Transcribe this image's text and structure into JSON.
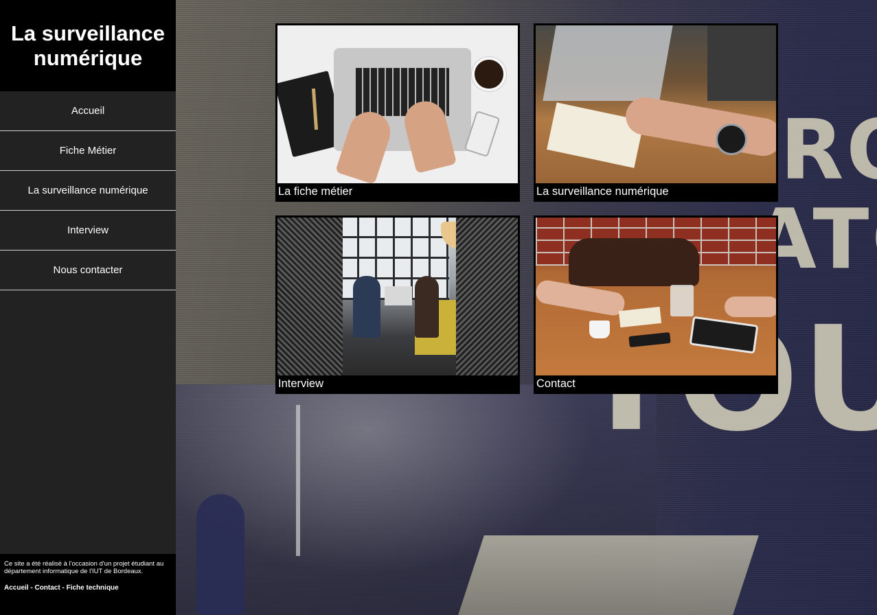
{
  "site": {
    "title": "La surveillance numérique"
  },
  "nav": {
    "items": [
      {
        "label": "Accueil"
      },
      {
        "label": "Fiche Métier"
      },
      {
        "label": "La surveillance numérique"
      },
      {
        "label": "Interview"
      },
      {
        "label": "Nous contacter"
      }
    ]
  },
  "tiles": [
    {
      "caption": "La fiche métier"
    },
    {
      "caption": "La surveillance numérique"
    },
    {
      "caption": "Interview"
    },
    {
      "caption": "Contact"
    }
  ],
  "footer": {
    "text": "Ce site a été réalisé à l'occasion d'un projet étudiant au département informatique de l'IUT de Bordeaux.",
    "links": [
      {
        "label": "Accueil"
      },
      {
        "label": "Contact"
      },
      {
        "label": "Fiche technique"
      }
    ],
    "separator": " - "
  },
  "background": {
    "words": [
      "RO",
      "ATO",
      "YOU."
    ]
  },
  "colors": {
    "sidebar": "#222222",
    "brand_bg": "#000000",
    "text": "#ffffff"
  }
}
